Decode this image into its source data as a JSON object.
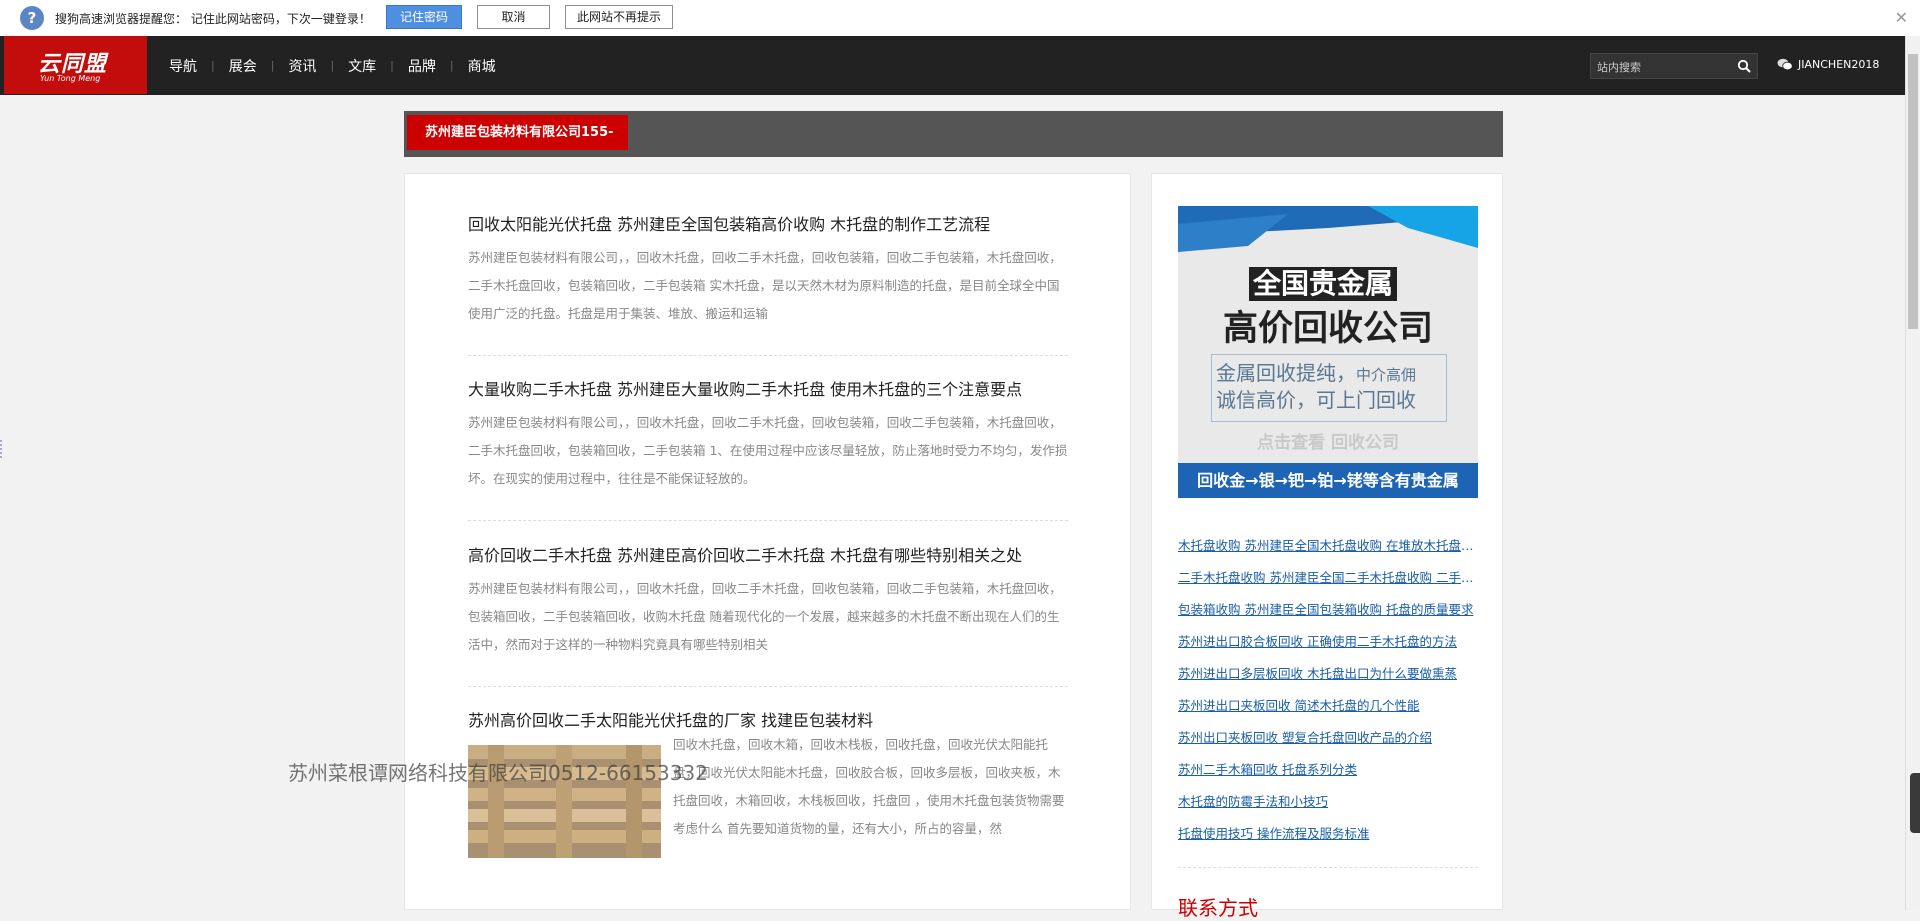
{
  "password_bar": {
    "message": "搜狗高速浏览器提醒您：  记住此网站密码，下次一键登录！",
    "remember_label": "记住密码",
    "cancel_label": "取消",
    "never_label": "此网站不再提示",
    "close_label": "✕"
  },
  "nav": {
    "logo_cn": "云同盟",
    "logo_en": "Yun Tong Meng",
    "menu": [
      "导航",
      "展会",
      "资讯",
      "文库",
      "品牌",
      "商城"
    ],
    "search_placeholder": "站内搜索",
    "user": "JIANCHEN2018"
  },
  "banner": {
    "company": "苏州建臣包装材料有限公司155-"
  },
  "articles": [
    {
      "title": "回收太阳能光伏托盘 苏州建臣全国包装箱高价收购 木托盘的制作工艺流程",
      "excerpt": "苏州建臣包装材料有限公司，，回收木托盘，回收二手木托盘，回收包装箱，回收二手包装箱，木托盘回收，二手木托盘回收，包装箱回收，二手包装箱 实木托盘，是以天然木材为原料制造的托盘，是目前全球全中国使用广泛的托盘。托盘是用于集装、堆放、搬运和运输"
    },
    {
      "title": "大量收购二手木托盘 苏州建臣大量收购二手木托盘 使用木托盘的三个注意要点",
      "excerpt": "苏州建臣包装材料有限公司，，回收木托盘，回收二手木托盘，回收包装箱，回收二手包装箱，木托盘回收，二手木托盘回收，包装箱回收，二手包装箱 1、在使用过程中应该尽量轻放，防止落地时受力不均匀，发作损坏。在现实的使用过程中，往往是不能保证轻放的。"
    },
    {
      "title": "高价回收二手木托盘 苏州建臣高价回收二手木托盘 木托盘有哪些特别相关之处",
      "excerpt": "苏州建臣包装材料有限公司，，回收木托盘，回收二手木托盘，回收包装箱，回收二手包装箱，木托盘回收，包装箱回收，二手包装箱回收，收购木托盘 随着现代化的一个发展，越来越多的木托盘不断出现在人们的生活中，然而对于这样的一种物料究竟具有哪些特别相关"
    },
    {
      "title": "苏州高价回收二手太阳能光伏托盘的厂家 找建臣包装材料",
      "excerpt": "回收木托盘，回收木箱，回收木栈板，回收托盘，回收光伏太阳能托盘，回收光伏太阳能木托盘，回收胶合板，回收多层板，回收夹板，木托盘回收，木箱回收，木栈板回收，托盘回 ，使用木托盘包装货物需要考虑什么 首先要知道货物的量，还有大小，所占的容量，然"
    }
  ],
  "ad": {
    "line1": "全国贵金属",
    "line2": "高价回收公司",
    "line3a": "金属回收提纯，",
    "line3b": "中介高佣",
    "line4": "诚信高价，可上门回收",
    "line5": "点击查看 回收公司",
    "bottom": "回收金→银→钯→铂→铑等含有贵金属",
    "colors": {
      "bottom_bar": "#1d64b5",
      "top_accent": "#1aa7e8"
    }
  },
  "sidebar_links": [
    "木托盘收购 苏州建臣全国木托盘收购 在堆放木托盘时应注意哪些",
    "二手木托盘收购 苏州建臣全国二手木托盘收购 二手木托盘",
    "包装箱收购 苏州建臣全国包装箱收购 托盘的质量要求",
    "苏州进出口胶合板回收 正确使用二手木托盘的方法",
    "苏州进出口多层板回收 木托盘出口为什么要做熏蒸",
    "苏州进出口夹板回收 简述木托盘的几个性能",
    "苏州出口夹板回收 塑复合托盘回收产品的介绍",
    "苏州二手木箱回收 托盘系列分类",
    "木托盘的防霉手法和小技巧",
    "托盘使用技巧 操作流程及服务标准"
  ],
  "contact_heading": "联系方式",
  "watermark": "苏州菜根谭网络科技有限公司0512-66153332"
}
